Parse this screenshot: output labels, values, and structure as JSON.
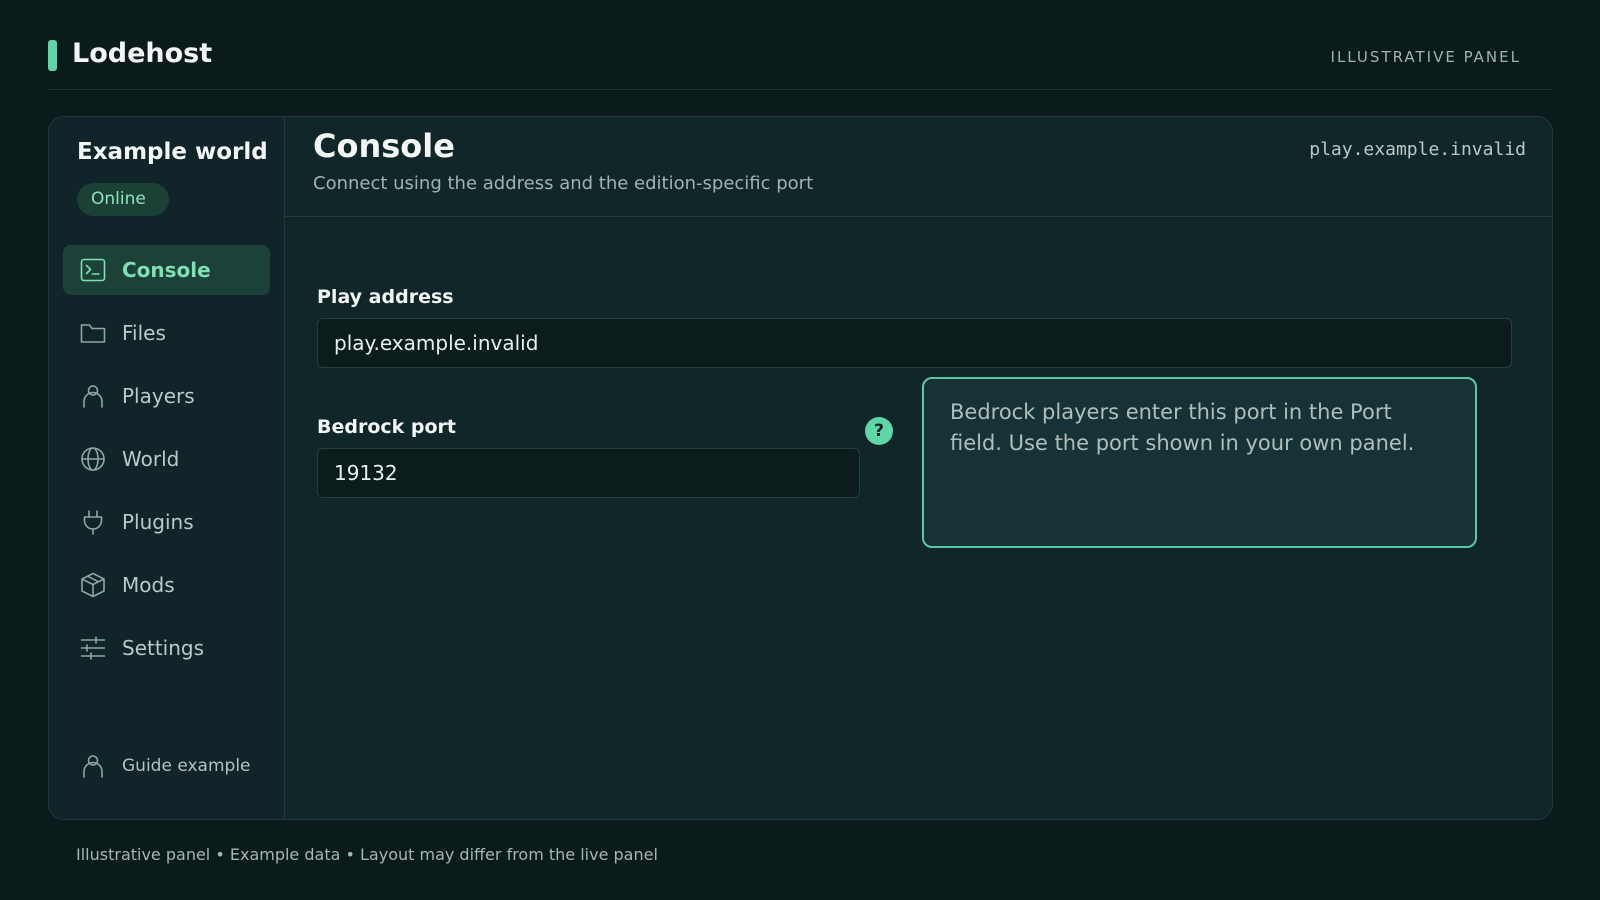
{
  "brand": {
    "name": "Lodehost",
    "accent": "#5fd6a8"
  },
  "top_label": "ILLUSTRATIVE PANEL",
  "sidebar": {
    "world_title": "Example world",
    "status": "Online",
    "items": [
      {
        "label": "Console",
        "icon": "terminal-icon",
        "active": true
      },
      {
        "label": "Files",
        "icon": "folder-icon"
      },
      {
        "label": "Players",
        "icon": "person-icon"
      },
      {
        "label": "World",
        "icon": "globe-icon"
      },
      {
        "label": "Plugins",
        "icon": "plug-icon"
      },
      {
        "label": "Mods",
        "icon": "cube-icon"
      },
      {
        "label": "Settings",
        "icon": "sliders-icon"
      }
    ],
    "footer_user": "Guide example"
  },
  "header": {
    "title": "Console",
    "subtitle": "Connect using the address and the edition-specific port",
    "host": "play.example.invalid"
  },
  "form": {
    "play_address": {
      "label": "Play address",
      "value": "play.example.invalid"
    },
    "bedrock_port": {
      "label": "Bedrock port",
      "value": "19132"
    },
    "help_symbol": "?",
    "tooltip": "Bedrock players enter this port in the Port field. Use the port shown in your own panel."
  },
  "footnote": "Illustrative panel • Example data • Layout may differ from the live panel"
}
